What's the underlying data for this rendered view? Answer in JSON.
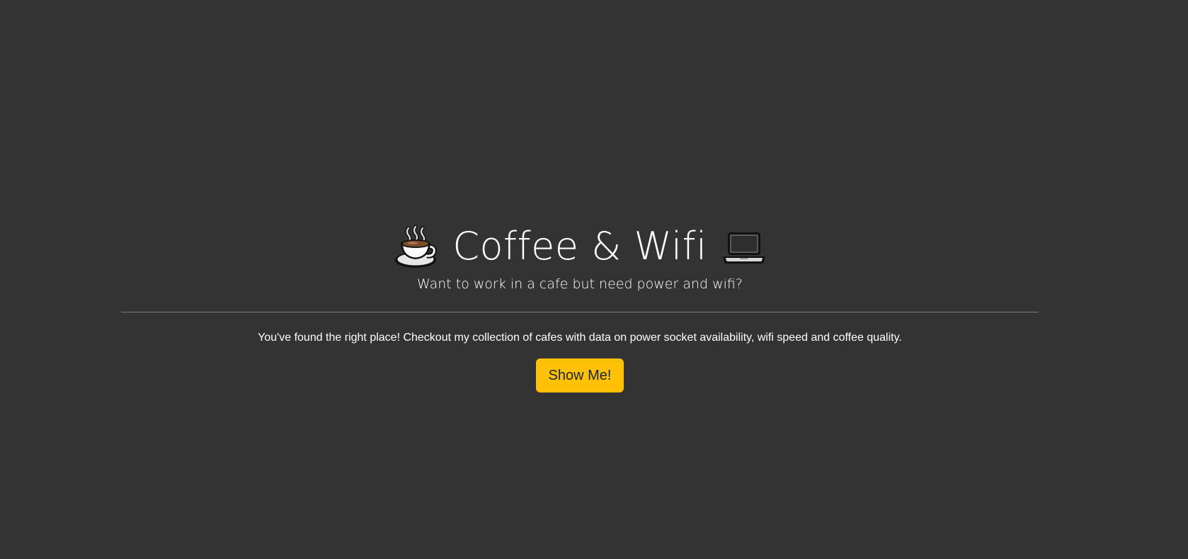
{
  "hero": {
    "title": "Coffee & Wifi",
    "left_icon": "coffee-cup-icon",
    "right_icon": "laptop-icon",
    "subtitle": "Want to work in a cafe but need power and wifi?",
    "lead": "You've found the right place! Checkout my collection of cafes with data on power socket availability, wifi speed and coffee quality.",
    "button_label": "Show Me!"
  },
  "colors": {
    "background": "#333333",
    "text": "#ffffff",
    "button": "#ffc107",
    "button_text": "#212529",
    "divider": "#7a7a7a"
  }
}
